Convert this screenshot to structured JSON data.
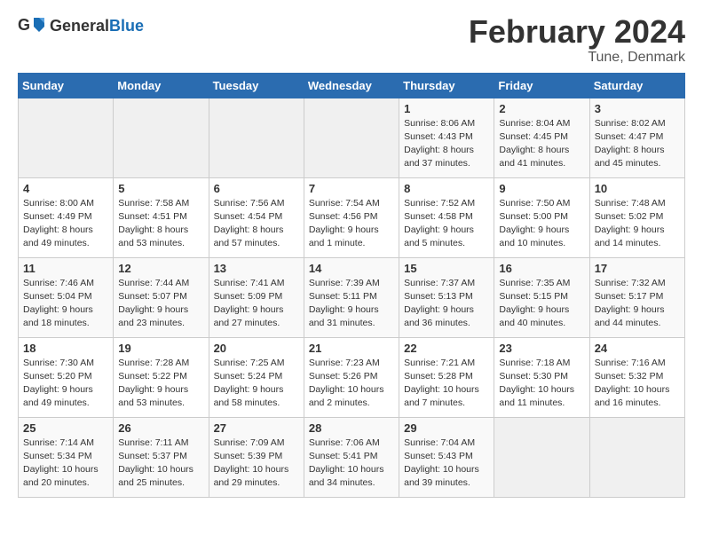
{
  "header": {
    "logo_general": "General",
    "logo_blue": "Blue",
    "title": "February 2024",
    "subtitle": "Tune, Denmark"
  },
  "weekdays": [
    "Sunday",
    "Monday",
    "Tuesday",
    "Wednesday",
    "Thursday",
    "Friday",
    "Saturday"
  ],
  "weeks": [
    [
      {
        "day": "",
        "info": ""
      },
      {
        "day": "",
        "info": ""
      },
      {
        "day": "",
        "info": ""
      },
      {
        "day": "",
        "info": ""
      },
      {
        "day": "1",
        "info": "Sunrise: 8:06 AM\nSunset: 4:43 PM\nDaylight: 8 hours\nand 37 minutes."
      },
      {
        "day": "2",
        "info": "Sunrise: 8:04 AM\nSunset: 4:45 PM\nDaylight: 8 hours\nand 41 minutes."
      },
      {
        "day": "3",
        "info": "Sunrise: 8:02 AM\nSunset: 4:47 PM\nDaylight: 8 hours\nand 45 minutes."
      }
    ],
    [
      {
        "day": "4",
        "info": "Sunrise: 8:00 AM\nSunset: 4:49 PM\nDaylight: 8 hours\nand 49 minutes."
      },
      {
        "day": "5",
        "info": "Sunrise: 7:58 AM\nSunset: 4:51 PM\nDaylight: 8 hours\nand 53 minutes."
      },
      {
        "day": "6",
        "info": "Sunrise: 7:56 AM\nSunset: 4:54 PM\nDaylight: 8 hours\nand 57 minutes."
      },
      {
        "day": "7",
        "info": "Sunrise: 7:54 AM\nSunset: 4:56 PM\nDaylight: 9 hours\nand 1 minute."
      },
      {
        "day": "8",
        "info": "Sunrise: 7:52 AM\nSunset: 4:58 PM\nDaylight: 9 hours\nand 5 minutes."
      },
      {
        "day": "9",
        "info": "Sunrise: 7:50 AM\nSunset: 5:00 PM\nDaylight: 9 hours\nand 10 minutes."
      },
      {
        "day": "10",
        "info": "Sunrise: 7:48 AM\nSunset: 5:02 PM\nDaylight: 9 hours\nand 14 minutes."
      }
    ],
    [
      {
        "day": "11",
        "info": "Sunrise: 7:46 AM\nSunset: 5:04 PM\nDaylight: 9 hours\nand 18 minutes."
      },
      {
        "day": "12",
        "info": "Sunrise: 7:44 AM\nSunset: 5:07 PM\nDaylight: 9 hours\nand 23 minutes."
      },
      {
        "day": "13",
        "info": "Sunrise: 7:41 AM\nSunset: 5:09 PM\nDaylight: 9 hours\nand 27 minutes."
      },
      {
        "day": "14",
        "info": "Sunrise: 7:39 AM\nSunset: 5:11 PM\nDaylight: 9 hours\nand 31 minutes."
      },
      {
        "day": "15",
        "info": "Sunrise: 7:37 AM\nSunset: 5:13 PM\nDaylight: 9 hours\nand 36 minutes."
      },
      {
        "day": "16",
        "info": "Sunrise: 7:35 AM\nSunset: 5:15 PM\nDaylight: 9 hours\nand 40 minutes."
      },
      {
        "day": "17",
        "info": "Sunrise: 7:32 AM\nSunset: 5:17 PM\nDaylight: 9 hours\nand 44 minutes."
      }
    ],
    [
      {
        "day": "18",
        "info": "Sunrise: 7:30 AM\nSunset: 5:20 PM\nDaylight: 9 hours\nand 49 minutes."
      },
      {
        "day": "19",
        "info": "Sunrise: 7:28 AM\nSunset: 5:22 PM\nDaylight: 9 hours\nand 53 minutes."
      },
      {
        "day": "20",
        "info": "Sunrise: 7:25 AM\nSunset: 5:24 PM\nDaylight: 9 hours\nand 58 minutes."
      },
      {
        "day": "21",
        "info": "Sunrise: 7:23 AM\nSunset: 5:26 PM\nDaylight: 10 hours\nand 2 minutes."
      },
      {
        "day": "22",
        "info": "Sunrise: 7:21 AM\nSunset: 5:28 PM\nDaylight: 10 hours\nand 7 minutes."
      },
      {
        "day": "23",
        "info": "Sunrise: 7:18 AM\nSunset: 5:30 PM\nDaylight: 10 hours\nand 11 minutes."
      },
      {
        "day": "24",
        "info": "Sunrise: 7:16 AM\nSunset: 5:32 PM\nDaylight: 10 hours\nand 16 minutes."
      }
    ],
    [
      {
        "day": "25",
        "info": "Sunrise: 7:14 AM\nSunset: 5:34 PM\nDaylight: 10 hours\nand 20 minutes."
      },
      {
        "day": "26",
        "info": "Sunrise: 7:11 AM\nSunset: 5:37 PM\nDaylight: 10 hours\nand 25 minutes."
      },
      {
        "day": "27",
        "info": "Sunrise: 7:09 AM\nSunset: 5:39 PM\nDaylight: 10 hours\nand 29 minutes."
      },
      {
        "day": "28",
        "info": "Sunrise: 7:06 AM\nSunset: 5:41 PM\nDaylight: 10 hours\nand 34 minutes."
      },
      {
        "day": "29",
        "info": "Sunrise: 7:04 AM\nSunset: 5:43 PM\nDaylight: 10 hours\nand 39 minutes."
      },
      {
        "day": "",
        "info": ""
      },
      {
        "day": "",
        "info": ""
      }
    ]
  ]
}
